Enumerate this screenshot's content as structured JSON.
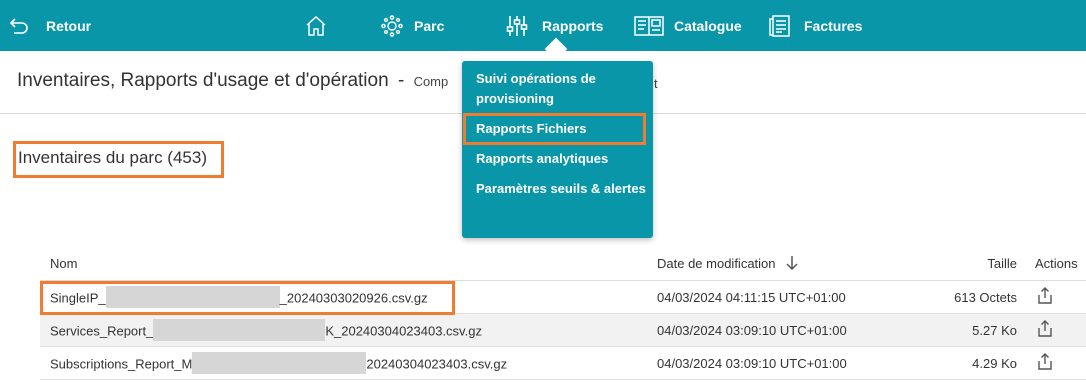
{
  "nav": {
    "back_label": "Retour",
    "items": [
      {
        "label": "",
        "icon": "home-icon"
      },
      {
        "label": "Parc",
        "icon": "network-icon"
      },
      {
        "label": "Rapports",
        "icon": "sliders-icon"
      },
      {
        "label": "Catalogue",
        "icon": "catalogue-icon"
      },
      {
        "label": "Factures",
        "icon": "invoice-icon"
      }
    ],
    "bar_color": "#0a96a9"
  },
  "header": {
    "title": "Inventaires, Rapports d'usage et d'opération",
    "separator": "-",
    "subtitle": "Comp"
  },
  "section": {
    "title": "Inventaires du parc (453)"
  },
  "rapports_menu": {
    "items": [
      "Suivi opérations de provisioning",
      "Rapports Fichiers",
      "Rapports analytiques",
      "Paramètres seuils & alertes"
    ],
    "highlighted": "Rapports Fichiers",
    "partially_hidden_text": "t"
  },
  "table": {
    "headers": {
      "name": "Nom",
      "date": "Date de modification",
      "size": "Taille",
      "actions": "Actions"
    },
    "sort": "descending",
    "rows": [
      {
        "name_prefix": "SingleIP_",
        "name_suffix": "_20240303020926.csv.gz",
        "date": "04/03/2024 04:11:15 UTC+01:00",
        "size": "613 Octets"
      },
      {
        "name_prefix": "Services_Report_",
        "name_suffix": "K_20240304023403.csv.gz",
        "date": "04/03/2024 03:09:10 UTC+01:00",
        "size": "5.27 Ko"
      },
      {
        "name_prefix": "Subscriptions_Report_M",
        "name_suffix": "20240304023403.csv.gz",
        "date": "04/03/2024 03:09:10 UTC+01:00",
        "size": "4.29 Ko"
      }
    ]
  },
  "highlight_color": "#ee7d31"
}
